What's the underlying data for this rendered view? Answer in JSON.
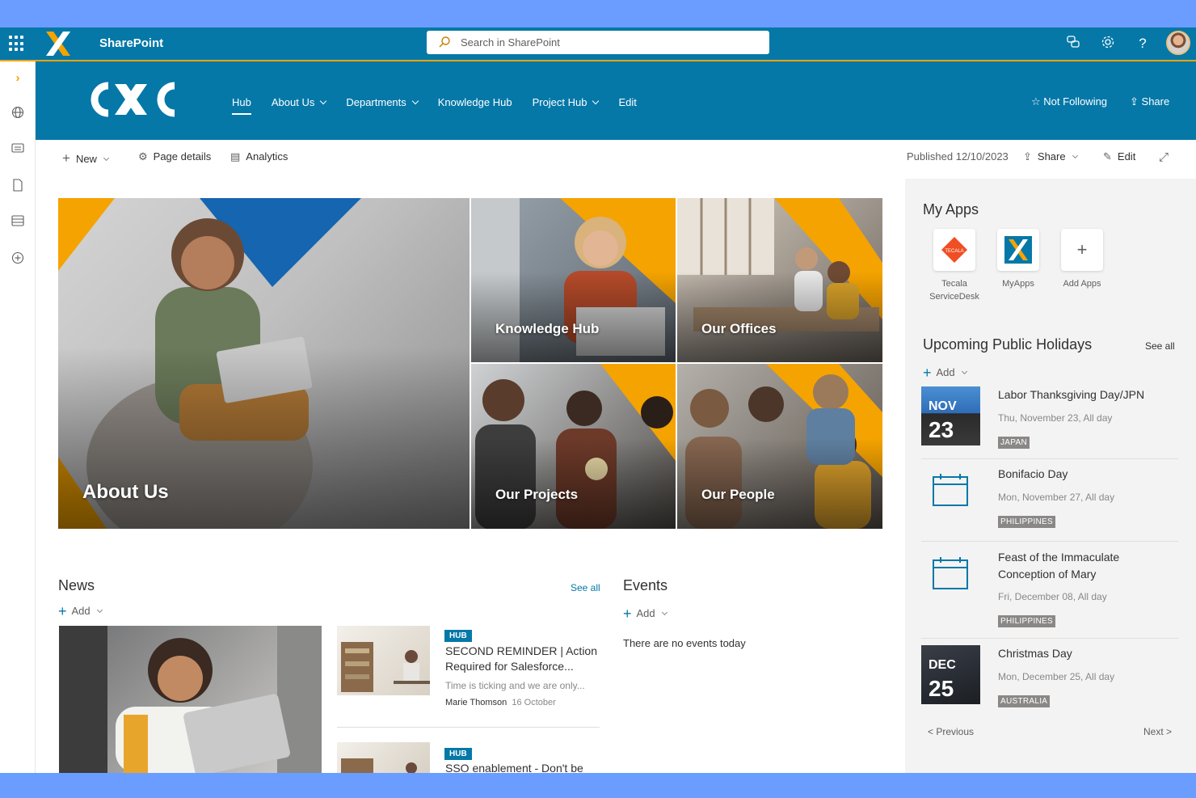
{
  "suite": {
    "title": "SharePoint",
    "search_placeholder": "Search in SharePoint"
  },
  "site": {
    "logo_text": "CXC",
    "nav": [
      {
        "label": "Hub",
        "active": true,
        "dropdown": false
      },
      {
        "label": "About Us",
        "dropdown": true
      },
      {
        "label": "Departments",
        "dropdown": true
      },
      {
        "label": "Knowledge Hub",
        "dropdown": false
      },
      {
        "label": "Project Hub",
        "dropdown": true
      },
      {
        "label": "Edit",
        "dropdown": false
      }
    ],
    "not_following": "Not Following",
    "share": "Share"
  },
  "commandbar": {
    "new": "New",
    "page_details": "Page details",
    "analytics": "Analytics",
    "published": "Published 12/10/2023",
    "share": "Share",
    "edit": "Edit"
  },
  "hero": {
    "tiles": [
      "About Us",
      "Knowledge Hub",
      "Our Offices",
      "Our Projects",
      "Our People"
    ]
  },
  "news": {
    "title": "News",
    "see_all": "See all",
    "add": "Add",
    "items": [
      {
        "badge": "HUB",
        "title": "SECOND REMINDER | Action Required for Salesforce...",
        "desc": "Time is ticking and we are only...",
        "author": "Marie Thomson",
        "date": "16 October"
      },
      {
        "badge": "HUB",
        "title": "SSO enablement - Don't be"
      }
    ]
  },
  "events": {
    "title": "Events",
    "add": "Add",
    "empty": "There are no events today"
  },
  "my_apps": {
    "title": "My Apps",
    "apps": [
      {
        "line1": "Tecala",
        "line2": "ServiceDesk"
      },
      {
        "line1": "MyApps",
        "line2": ""
      },
      {
        "line1": "Add Apps",
        "line2": ""
      }
    ],
    "tecala_logo_text": "TECALA"
  },
  "holidays": {
    "title": "Upcoming Public Holidays",
    "see_all": "See all",
    "add": "Add",
    "items": [
      {
        "title": "Labor Thanksgiving Day/JPN",
        "date": "Thu, November 23, All day",
        "tag": "JAPAN",
        "month": "NOV",
        "day": "23"
      },
      {
        "title": "Bonifacio Day",
        "date": "Mon, November 27, All day",
        "tag": "PHILIPPINES"
      },
      {
        "title": "Feast of the Immaculate Conception of Mary",
        "date": "Fri, December 08, All day",
        "tag": "PHILIPPINES"
      },
      {
        "title": "Christmas Day",
        "date": "Mon, December 25, All day",
        "tag": "AUSTRALIA",
        "month": "DEC",
        "day": "25"
      }
    ],
    "previous": "< Previous",
    "next": "Next >"
  },
  "colors": {
    "brand_blue": "#0578a8",
    "accent_orange": "#f5a300",
    "frame_blue": "#6b9cff"
  }
}
